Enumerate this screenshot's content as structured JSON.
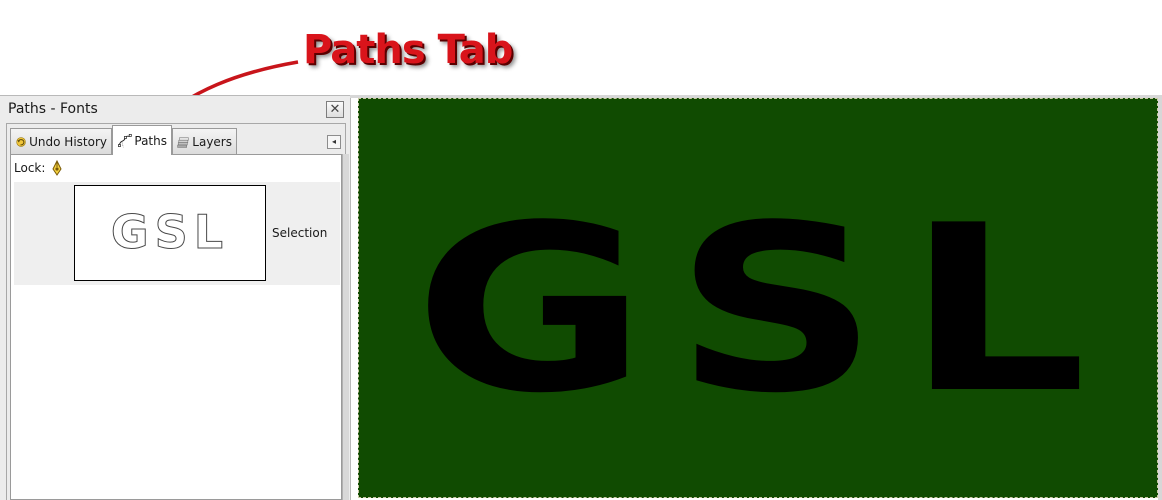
{
  "annotation": {
    "label": "Paths Tab",
    "color": "#d9141b"
  },
  "dock": {
    "title": "Paths - Fonts",
    "close_icon": "close-icon",
    "tabs": [
      {
        "label": "Undo History",
        "icon": "undo-history-icon",
        "active": false
      },
      {
        "label": "Paths",
        "icon": "paths-icon",
        "active": true
      },
      {
        "label": "Layers",
        "icon": "layers-icon",
        "active": false
      }
    ],
    "tab_menu_icon": "tab-menu-arrow-icon",
    "lock_label": "Lock:",
    "lock_icon": "lock-path-icon",
    "paths": [
      {
        "name": "Selection",
        "thumbnail_text": "GSL"
      }
    ]
  },
  "canvas": {
    "background_color": "#104b01",
    "text": "GSL",
    "text_color": "#000000"
  }
}
